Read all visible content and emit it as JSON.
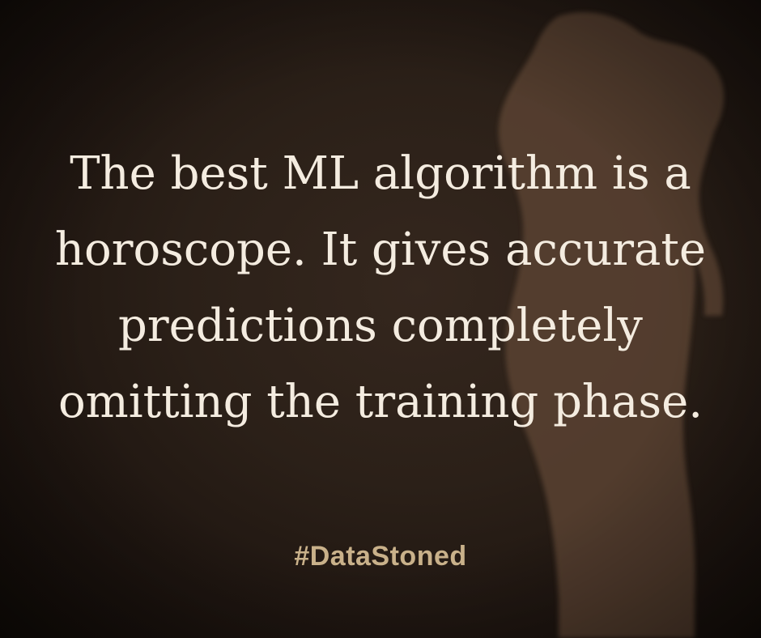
{
  "quote": {
    "lines": [
      "The best ML algorithm is a",
      "horoscope. It gives accurate",
      "predictions completely",
      "omitting the training phase."
    ]
  },
  "hashtag": "#DataStoned",
  "colors": {
    "background": "#2b2018",
    "silhouette": "#5a4232",
    "quote_text": "#f4ece0",
    "hashtag_text": "#c9b18a"
  },
  "background_image": "figure-silhouette"
}
